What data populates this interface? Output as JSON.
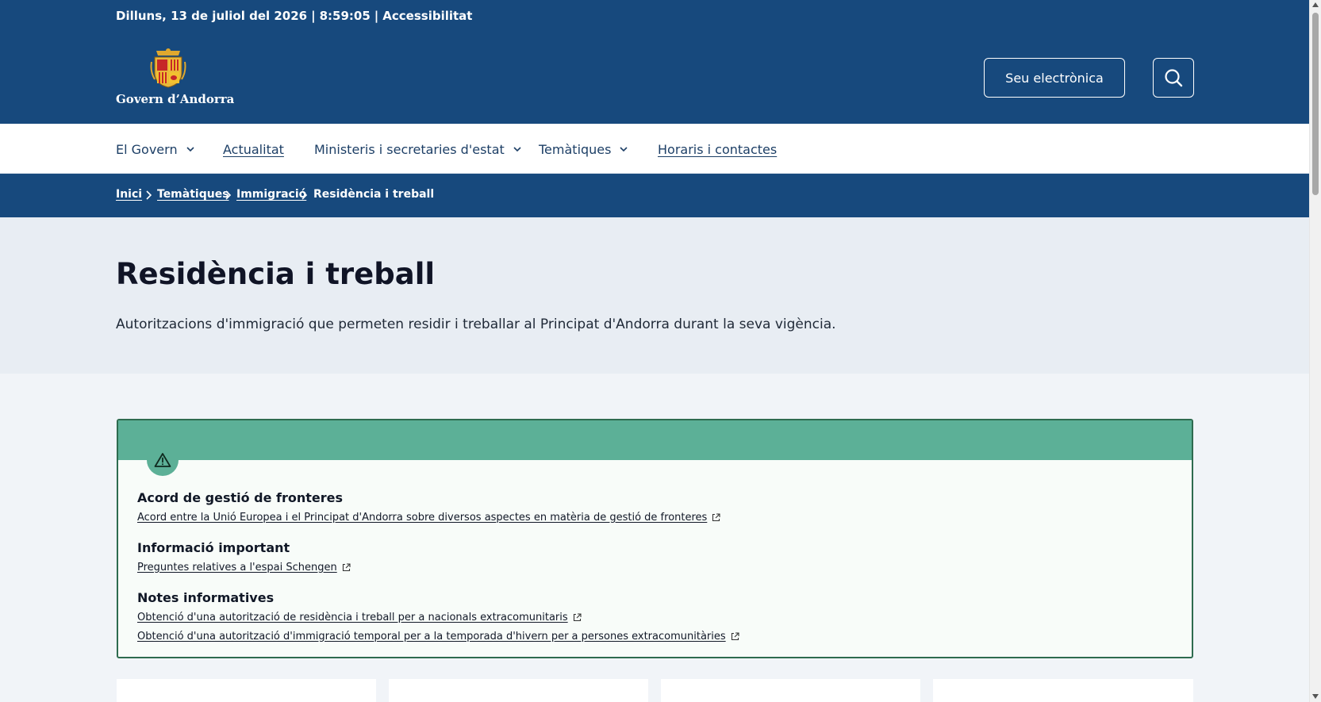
{
  "header": {
    "date": "Dilluns, 13 de juliol del 2026",
    "time": "8:59:05",
    "separator": "|",
    "accessibility": "Accessibilitat",
    "logo_text": "Govern d’Andorra",
    "logo_icon": "andorra-coat-of-arms",
    "seu_button": "Seu electrònica",
    "search_icon": "search-icon"
  },
  "nav": {
    "items": [
      {
        "label": "El Govern",
        "dropdown": true
      },
      {
        "label": "Actualitat",
        "dropdown": false
      },
      {
        "label": "Ministeris i secretaries d'estat",
        "dropdown": true
      },
      {
        "label": "Temàtiques",
        "dropdown": true
      },
      {
        "label": "Horaris i contactes",
        "dropdown": false
      }
    ]
  },
  "breadcrumb": {
    "items": [
      "Inici",
      "Temàtiques",
      "Immigració",
      "Residència i treball"
    ]
  },
  "hero": {
    "title": "Residència i treball",
    "description": "Autoritzacions d'immigració que permeten residir i treballar al Principat d'Andorra durant la seva vigència."
  },
  "alert": {
    "icon": "warning-icon",
    "sections": [
      {
        "heading": "Acord de gestió de fronteres",
        "links": [
          "Acord entre la Unió Europea i el Principat d'Andorra sobre diversos aspectes en matèria de gestió de fronteres"
        ]
      },
      {
        "heading": "Informació important",
        "links": [
          "Preguntes relatives a l'espai Schengen"
        ]
      },
      {
        "heading": "Notes informatives",
        "links": [
          "Obtenció d'una autorització de residència i treball per a nacionals extracomunitaris",
          "Obtenció d'una autorització d'immigració temporal per a la temporada d'hivern per a persones extracomunitàries"
        ]
      }
    ]
  },
  "colors": {
    "header_bg": "#17497d",
    "hero_bg": "#e8edf3",
    "alert_band": "#5cb097",
    "alert_border": "#2e6b4f"
  }
}
